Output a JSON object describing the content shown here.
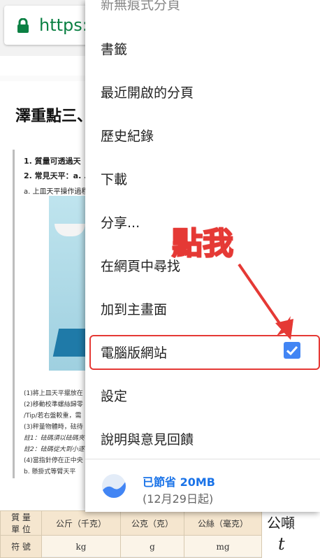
{
  "browser": {
    "url_text": "https://j"
  },
  "page": {
    "heading": "澤重點三、",
    "doc_lines": [
      "1. 質量可透過天",
      "2. 常見天平：a. .",
      "a. 上皿天平操作過程"
    ],
    "notes": [
      "(1)將上皿天平擺放在",
      "(2)移動校準螺絲歸零",
      "/Tip/若右盤較重，需",
      "(3)秤量物體時，砝待",
      "註1：砝碼須以砝碼夾",
      "註2：砝碼從大到小逐",
      "(4)當指針停在正中央",
      "b. 懸掛式等臂天平"
    ],
    "table": {
      "row1": [
        "質 量\n單 位",
        "公斤（千克）",
        "公克（克）",
        "公絲（毫克）"
      ],
      "row2": [
        "符 號",
        "kg",
        "g",
        "mg"
      ],
      "side_top": "公噸",
      "side_bottom": "t"
    }
  },
  "menu": {
    "cut_item": "新無痕式分頁",
    "items": [
      {
        "label": "書籤"
      },
      {
        "label": "最近開啟的分頁"
      },
      {
        "label": "歷史紀錄"
      },
      {
        "label": "下載"
      },
      {
        "label": "分享..."
      },
      {
        "label": "在網頁中尋找"
      },
      {
        "label": "加到主畫面"
      },
      {
        "label": "電腦版網站",
        "checked": true
      },
      {
        "label": "設定"
      },
      {
        "label": "說明與意見回饋"
      }
    ],
    "savings": {
      "title": "已節省 20MB",
      "date": "(12月29日起)"
    }
  },
  "annotation": {
    "callout": "點我"
  },
  "colors": {
    "accent_blue": "#4285f4",
    "highlight_red": "#e53935",
    "url_green": "#0b8043"
  }
}
